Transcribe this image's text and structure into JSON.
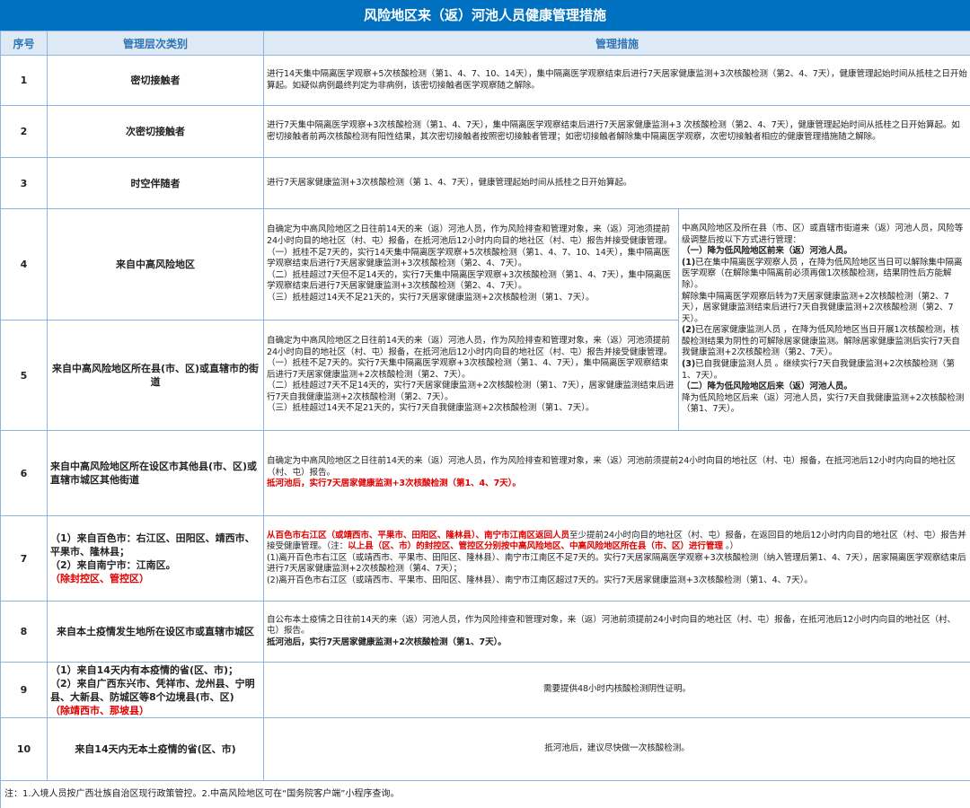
{
  "title": "风险地区来（返）河池人员健康管理措施",
  "headers": {
    "no": "序号",
    "category": "管理层次类别",
    "measures": "管理措施"
  },
  "colors": {
    "header_bg": "#0070c0",
    "subheader_bg": "#dde9f5",
    "emphasis_red": "#e00000"
  },
  "rows": [
    {
      "no": "1",
      "category": [
        {
          "t": "密切接触者"
        }
      ],
      "measures": [
        [
          {
            "t": "进行14天集中隔离医学观察+5次核酸检测（第1、4、7、10、14天），集中隔离医学观察结束后进行7天居家健康监测+3次核酸检测（第2、4、7天），健康管理起始时间从抵桂之日开始算起。如疑似病例最终判定为非病例，该密切接触者医学观察随之解除。"
          }
        ]
      ]
    },
    {
      "no": "2",
      "category": [
        {
          "t": "次密切接触者"
        }
      ],
      "measures": [
        [
          {
            "t": "进行7天集中隔离医学观察+3次核酸检测（第1、4、7天），集中隔离医学观察结束后进行7天居家健康监测+3 次核酸检测（第2、4、7天），健康管理起始时间从抵桂之日开始算起。如密切接触者前两次核酸检测有阳性结果，其次密切接触者按照密切接触者管理；如密切接触者解除集中隔离医学观察，次密切接触者相应的健康管理措施随之解除。"
          }
        ]
      ]
    },
    {
      "no": "3",
      "category": [
        {
          "t": "时空伴随者"
        }
      ],
      "measures": [
        [
          {
            "t": "进行7天居家健康监测+3次核酸检测（第 1、4、7天），健康管理起始时间从抵桂之日开始算起。"
          }
        ]
      ]
    },
    {
      "no": "4",
      "category": [
        {
          "t": "来自中高风险地区"
        }
      ],
      "measures": [
        [
          {
            "t": "自确定为中高风险地区之日往前14天的来（返）河池人员，作为风险排查和管理对象，来（返）河池须提前24小时向目的地社区（村、屯）报备，在抵河池后12小时内向目的地社区（村、屯）报告并接受健康管理。"
          }
        ],
        [
          {
            "t": "（一）抵桂不足7天的，实行14天集中隔离医学观察+5次核酸检测（第1、4、7、10、14天），集中隔离医学观察结束后进行7天居家健康监测+3次核酸检测（第2、4、7天）。"
          }
        ],
        [
          {
            "t": "（二）抵桂超过7天但不足14天的，实行7天集中隔离医学观察+3次核酸检测（第1、4、7天），集中隔离医学观察结束后进行7天居家健康监测+3次核酸检测（第2、4、7天）。"
          }
        ],
        [
          {
            "t": "（三）抵桂超过14天不足21天的，实行7天居家健康监测+2次核酸检测（第1、7天）。"
          }
        ]
      ]
    },
    {
      "no": "5",
      "category": [
        {
          "t": "来自中高风险地区所在县(市、区)或直辖市的街道"
        }
      ],
      "measures": [
        [
          {
            "t": "自确定为中高风险地区之日往前14天的来（返）河池人员，作为风险排查和管理对象，来（返）河池须提前24小时向目的地社区（村、屯）报备，在抵河池后12小时内向目的地社区（村、屯）报告并接受健康管理。"
          }
        ],
        [
          {
            "t": "（一）抵桂不足7天的。实行7天集中隔离医学观察+3次核酸检测（第1、4、7天），集中隔离医学观察结束后进行7天居家健康监测+2次核酸检测（第2、7天）。"
          }
        ],
        [
          {
            "t": "（二）抵桂超过7天不足14天的，实行7天居家健康监测+2次核酸检测（第1、7天），居家健康监测结束后进行7天自我健康监测+2次核酸检测（第2、7天）。"
          }
        ],
        [
          {
            "t": "（三）抵桂超过14天不足21天的，实行7天自我健康监测+2次核酸检测（第1、7天）。"
          }
        ]
      ]
    },
    {
      "no": "6",
      "category": [
        {
          "t": "来自中高风险地区所在设区市其他县(市、区)或直辖市城区其他街道"
        }
      ],
      "left": true,
      "measures": [
        [
          {
            "t": "自确定为中高风险地区之日往前14天的来（返）河池人员，作为风险排查和管理对象，来（返）河池前须提前24小时向目的地社区（村、屯）报备，在抵河池后12小时内向目的地社区（村、屯）报告。"
          }
        ],
        [
          {
            "t": "抵河池后，实行7天居家健康监测+3次核酸检测（第1、4、7天）。",
            "c": "red"
          }
        ]
      ]
    },
    {
      "no": "7",
      "left": true,
      "category": [
        {
          "t": "（1）来自百色市：右江区、田阳区、靖西市、平果市、隆林县；"
        },
        {
          "t": "（2）来自南宁市：江南区。"
        },
        {
          "t": "（除封控区、管控区）",
          "c": "red"
        }
      ],
      "measures": [
        [
          {
            "t": "从百色市右江区（或靖西市、平果市、田阳区、隆林县）、南宁市江南区返回人员",
            "c": "red"
          },
          {
            "t": "至少提前24小时向目的地社区（村、屯）报备，在返回目的地后12小时内向目的地社区（村、屯）报告并接受健康管理。（注："
          },
          {
            "t": "以上县（区、市）的封控区、管控区分别按中高风险地区、中高风险地区所在县（市、区）进行管理",
            "c": "red"
          },
          {
            "t": " 。）"
          }
        ],
        [
          {
            "t": "(1)离开百色市右江区（或靖西市、平果市、田阳区、隆林县）、南宁市江南区不足7天的。实行7天居家隔离医学观察+3次核酸检测（纳入管理后第1、4、7天），居家隔离医学观察结束后进行7天居家健康监测+2次核酸检测（第4、7天）；"
          }
        ],
        [
          {
            "t": "(2)离开百色市右江区（或靖西市、平果市、田阳区、隆林县）、南宁市江南区超过7天的。实行7天居家健康监测+3次核酸检测（第1、4、7天）。"
          }
        ]
      ]
    },
    {
      "no": "8",
      "category": [
        {
          "t": "来自本土疫情发生地所在设区市或直辖市城区"
        }
      ],
      "measures": [
        [
          {
            "t": "自公布本土疫情之日往前14天的来（返）河池人员，作为风险排查和管理对象，来（返）河池前须提前24小时向目的地社区（村、屯）报备，在抵河池后12小时内向目的地社区（村、屯）报告。"
          }
        ],
        [
          {
            "t": "抵河池后，实行7天居家健康监测+2次核酸检测（第1、7天）。",
            "c": "b"
          }
        ]
      ]
    },
    {
      "no": "9",
      "left": true,
      "category": [
        {
          "t": "（1）来自14天内有本疫情的省(区、市)；"
        },
        {
          "t": "（2）来自广西东兴市、凭祥市、龙州县、宁明县、大新县、防城区等8个边境县(市、区)"
        },
        {
          "t": "（除靖西市、那坡县）",
          "c": "red"
        }
      ],
      "center": true,
      "measures": [
        [
          {
            "t": "需要提供48小时内核酸检测阴性证明。"
          }
        ]
      ]
    },
    {
      "no": "10",
      "category": [
        {
          "t": "来自14天内无本土疫情的省(区、市)"
        }
      ],
      "center": true,
      "measures": [
        [
          {
            "t": "抵河池后，建议尽快做一次核酸检测。"
          }
        ]
      ]
    }
  ],
  "adjustment": [
    [
      {
        "t": "中高风险地区及所在县（市、区）或直辖市街道来（返）河池人员，风险等级调整后按以下方式进行管理："
      }
    ],
    [
      {
        "t": "（一）降为低风险地区前来（返）河池人员。",
        "c": "b"
      }
    ],
    [
      {
        "t": "(1)",
        "c": "b"
      },
      {
        "t": "已在集中隔离医学观察人员 ，在降为低风险地区当日可以解除集中隔离医学观察（在解除集中隔离前必须再做1次核酸检测，结果阴性后方能解除）。"
      }
    ],
    [
      {
        "t": "解除集中隔离医学观察后转为7天居家健康监测+2次核酸检测（第2、7天），居家健康监测结束后进行7天自我健康监测+2次核酸检测（第2、7天）。"
      }
    ],
    [
      {
        "t": "(2)",
        "c": "b"
      },
      {
        "t": "已在居家健康监测人员 ，在降为低风险地区当日开展1次核酸检测，核酸检测结果为阴性的可解除居家健康监测。解除居家健康监测后实行7天自我健康监测+2次核酸检测（第2、7天）。"
      }
    ],
    [
      {
        "t": "(3)",
        "c": "b"
      },
      {
        "t": "已自我健康监测人员 。继续实行7天自我健康监测+2次核酸检测（第1、7天）。"
      }
    ],
    [
      {
        "t": "（二）降为低风险地区后来（返）河池人员。",
        "c": "b"
      }
    ],
    [
      {
        "t": "降为低风险地区后来（返）河池人员，实行7天自我健康监测+2次核酸检测（第1、7天）。"
      }
    ]
  ],
  "footnote": "注：1.入境人员按广西壮族自治区现行政策管控。2.中高风险地区可在“国务院客户端”小程序查询。"
}
